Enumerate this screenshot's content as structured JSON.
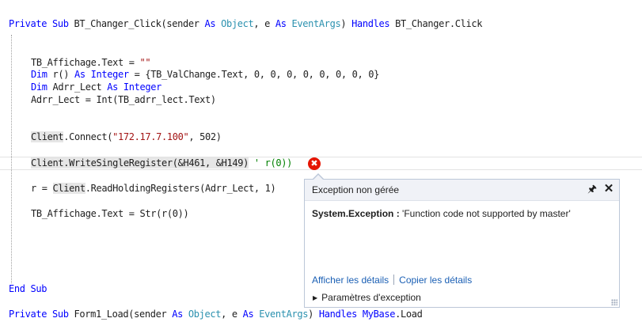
{
  "code": {
    "line1": {
      "kw1": "Private Sub",
      "t1": " BT_Changer_Click(sender ",
      "kw2": "As",
      "t2": " ",
      "ty1": "Object",
      "t3": ", e ",
      "kw3": "As",
      "t4": " ",
      "ty2": "EventArgs",
      "t5": ") ",
      "kw4": "Handles",
      "t6": " BT_Changer.Click"
    },
    "line2": {
      "t1": "TB_Affichage.Text = ",
      "str1": "\"\""
    },
    "line3": {
      "kw1": "Dim",
      "t1": " r() ",
      "kw2": "As",
      "t2": " ",
      "kw3": "Integer",
      "t3": " = {TB_ValChange.Text, 0, 0, 0, 0, 0, 0, 0, 0}"
    },
    "line4": {
      "kw1": "Dim",
      "t1": " Adrr_Lect ",
      "kw2": "As",
      "t2": " ",
      "kw3": "Integer"
    },
    "line5": {
      "t1": "Adrr_Lect = Int(TB_adrr_lect.Text)"
    },
    "line6": {
      "hl1": "Client",
      "t1": ".Connect(",
      "str1": "\"172.17.7.100\"",
      "t2": ", 502)"
    },
    "line7": {
      "hl1": "Client.WriteSingleRegister(&H461, &H149)",
      "cm1": " ' r(0))"
    },
    "line8": {
      "t1": "r = ",
      "hl1": "Client",
      "t2": ".ReadHoldingRegisters(Adrr_Lect, 1)"
    },
    "line9": {
      "t1": "TB_Affichage.Text = Str(r(0))"
    },
    "line10": {
      "kw1": "End Sub"
    },
    "line11": {
      "kw1": "Private Sub",
      "t1": " Form1_Load(sender ",
      "kw2": "As",
      "t2": " ",
      "ty1": "Object",
      "t3": ", e ",
      "kw3": "As",
      "t4": " ",
      "ty2": "EventArgs",
      "t5": ") ",
      "kw4": "Handles",
      "t6": " ",
      "kw5": "MyBase",
      "t7": ".Load"
    }
  },
  "error_icon": {
    "glyph": "✖",
    "name": "error-icon"
  },
  "exception_popup": {
    "title": "Exception non gérée",
    "pin_glyph": "🖈",
    "close_glyph": "✕",
    "exception_type": "System.Exception :",
    "exception_message": " 'Function code not supported by master'",
    "link_details": "Afficher les détails",
    "link_copy": "Copier les détails",
    "params_label": "Paramètres d'exception",
    "params_arrow": "▶"
  },
  "colors": {
    "keyword": "#0000ff",
    "type": "#2b91af",
    "string": "#a31515",
    "comment": "#008000",
    "error": "#e51400",
    "link": "#1a5fb4"
  }
}
